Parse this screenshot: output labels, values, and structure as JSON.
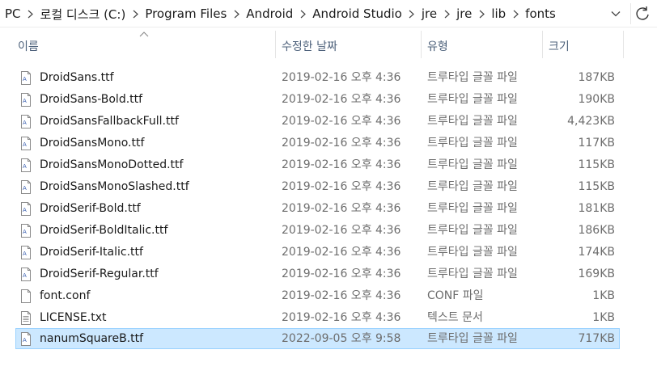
{
  "addressbar": {
    "crumbs": [
      "PC",
      "로컬 디스크 (C:)",
      "Program Files",
      "Android",
      "Android Studio",
      "jre",
      "jre",
      "lib",
      "fonts"
    ]
  },
  "columns": {
    "name": "이름",
    "date": "수정한 날짜",
    "type": "유형",
    "size": "크기"
  },
  "files": [
    {
      "name": "DroidSans.ttf",
      "date": "2019-02-16 오후 4:36",
      "type": "트루타입 글꼴 파일",
      "size": "187KB",
      "icon": "font-file-icon",
      "selected": false
    },
    {
      "name": "DroidSans-Bold.ttf",
      "date": "2019-02-16 오후 4:36",
      "type": "트루타입 글꼴 파일",
      "size": "190KB",
      "icon": "font-file-icon",
      "selected": false
    },
    {
      "name": "DroidSansFallbackFull.ttf",
      "date": "2019-02-16 오후 4:36",
      "type": "트루타입 글꼴 파일",
      "size": "4,423KB",
      "icon": "font-file-icon",
      "selected": false
    },
    {
      "name": "DroidSansMono.ttf",
      "date": "2019-02-16 오후 4:36",
      "type": "트루타입 글꼴 파일",
      "size": "117KB",
      "icon": "font-file-icon",
      "selected": false
    },
    {
      "name": "DroidSansMonoDotted.ttf",
      "date": "2019-02-16 오후 4:36",
      "type": "트루타입 글꼴 파일",
      "size": "115KB",
      "icon": "font-file-icon",
      "selected": false
    },
    {
      "name": "DroidSansMonoSlashed.ttf",
      "date": "2019-02-16 오후 4:36",
      "type": "트루타입 글꼴 파일",
      "size": "115KB",
      "icon": "font-file-icon",
      "selected": false
    },
    {
      "name": "DroidSerif-Bold.ttf",
      "date": "2019-02-16 오후 4:36",
      "type": "트루타입 글꼴 파일",
      "size": "181KB",
      "icon": "font-file-icon",
      "selected": false
    },
    {
      "name": "DroidSerif-BoldItalic.ttf",
      "date": "2019-02-16 오후 4:36",
      "type": "트루타입 글꼴 파일",
      "size": "186KB",
      "icon": "font-file-icon",
      "selected": false
    },
    {
      "name": "DroidSerif-Italic.ttf",
      "date": "2019-02-16 오후 4:36",
      "type": "트루타입 글꼴 파일",
      "size": "174KB",
      "icon": "font-file-icon",
      "selected": false
    },
    {
      "name": "DroidSerif-Regular.ttf",
      "date": "2019-02-16 오후 4:36",
      "type": "트루타입 글꼴 파일",
      "size": "169KB",
      "icon": "font-file-icon",
      "selected": false
    },
    {
      "name": "font.conf",
      "date": "2019-02-16 오후 4:36",
      "type": "CONF 파일",
      "size": "1KB",
      "icon": "blank-file-icon",
      "selected": false
    },
    {
      "name": "LICENSE.txt",
      "date": "2019-02-16 오후 4:36",
      "type": "텍스트 문서",
      "size": "1KB",
      "icon": "text-file-icon",
      "selected": false
    },
    {
      "name": "nanumSquareB.ttf",
      "date": "2022-09-05 오후 9:58",
      "type": "트루타입 글꼴 파일",
      "size": "717KB",
      "icon": "font-file-icon",
      "selected": true
    }
  ],
  "colors": {
    "selection_bg": "#cce8ff",
    "selection_border": "#99d1ff",
    "header_text": "#4c607a"
  }
}
